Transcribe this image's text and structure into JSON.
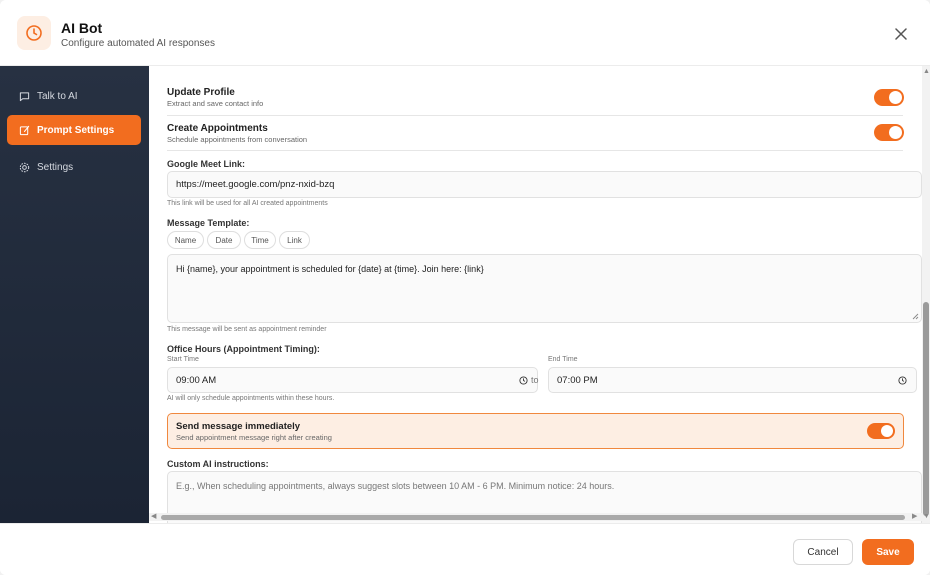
{
  "header": {
    "title": "AI Bot",
    "subtitle": "Configure automated AI responses",
    "icon": "clock-icon",
    "close_icon": "close-icon"
  },
  "sidebar": {
    "items": [
      {
        "label": "Talk to AI",
        "icon": "chat-icon",
        "active": false
      },
      {
        "label": "Prompt Settings",
        "icon": "edit-icon",
        "active": true
      },
      {
        "label": "Settings",
        "icon": "gear-icon",
        "active": false
      }
    ]
  },
  "content": {
    "update_profile": {
      "title": "Update Profile",
      "subtitle": "Extract and save contact info",
      "enabled": true
    },
    "create_appointments": {
      "title": "Create Appointments",
      "subtitle": "Schedule appointments from conversation",
      "enabled": true
    },
    "meet_link": {
      "label": "Google Meet Link:",
      "value": "https://meet.google.com/pnz-nxid-bzq",
      "hint": "This link will be used for all AI created appointments"
    },
    "message_template": {
      "label": "Message Template:",
      "chips": [
        "Name",
        "Date",
        "Time",
        "Link"
      ],
      "value": "Hi {name}, your appointment is scheduled for {date} at {time}. Join here: {link}",
      "hint": "This message will be sent as appointment reminder"
    },
    "office_hours": {
      "label": "Office Hours (Appointment Timing):",
      "start_label": "Start Time",
      "start_value": "09:00 AM",
      "to_text": "to",
      "end_label": "End Time",
      "end_value": "07:00 PM",
      "hint": "AI will only schedule appointments within these hours."
    },
    "send_immediately": {
      "title": "Send message immediately",
      "subtitle": "Send appointment message right after creating",
      "enabled": true
    },
    "custom_instructions": {
      "label": "Custom AI instructions:",
      "placeholder": "E.g., When scheduling appointments, always suggest slots between 10 AM - 6 PM. Minimum notice: 24 hours."
    }
  },
  "footer": {
    "cancel_label": "Cancel",
    "save_label": "Save"
  },
  "colors": {
    "accent": "#f26d1f",
    "sidebar_bg": "#273142",
    "highlight_bg": "#fdeee3"
  }
}
